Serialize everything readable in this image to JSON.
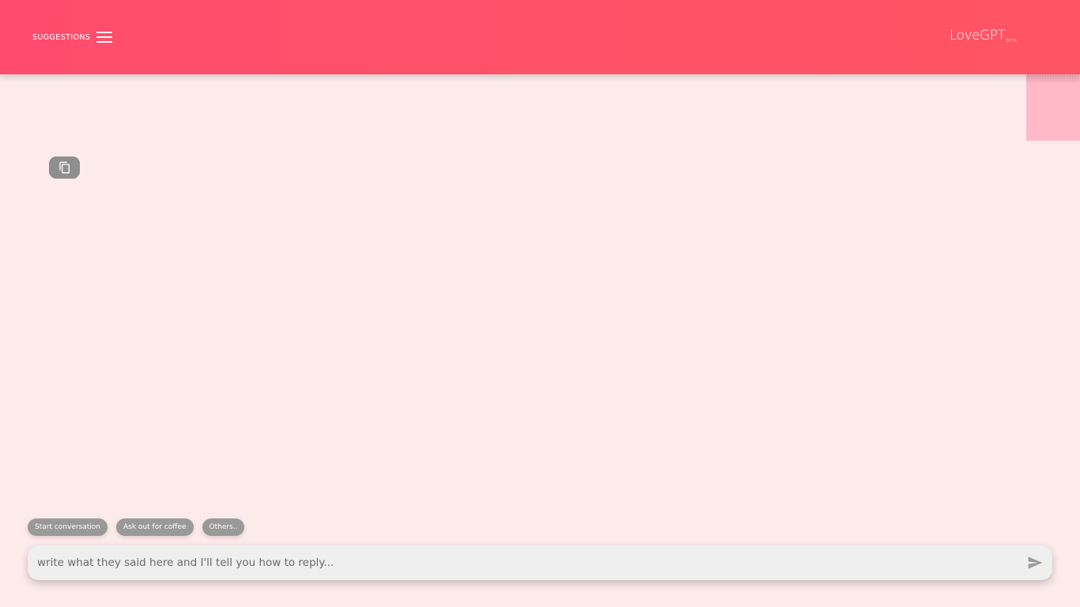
{
  "header": {
    "suggestions_label": "SUGGESTIONS",
    "menu_icon": "hamburger-menu-icon",
    "logo_text": "LoveGPT",
    "logo_badge": "BETA",
    "background": "#ff4f6a"
  },
  "conversation": {
    "copy_icon": "copy-icon"
  },
  "suggestion_chips": [
    {
      "label": "Start conversation"
    },
    {
      "label": "Ask out for coffee"
    },
    {
      "label": "Others.."
    }
  ],
  "composer": {
    "placeholder": "write what they said here and I'll tell you how to reply...",
    "value": "",
    "send_icon": "send-icon"
  },
  "colors": {
    "accent": "#ff4f6a",
    "page_background": "#fdebec",
    "chip_background": "#999999",
    "input_background": "#efefef"
  }
}
